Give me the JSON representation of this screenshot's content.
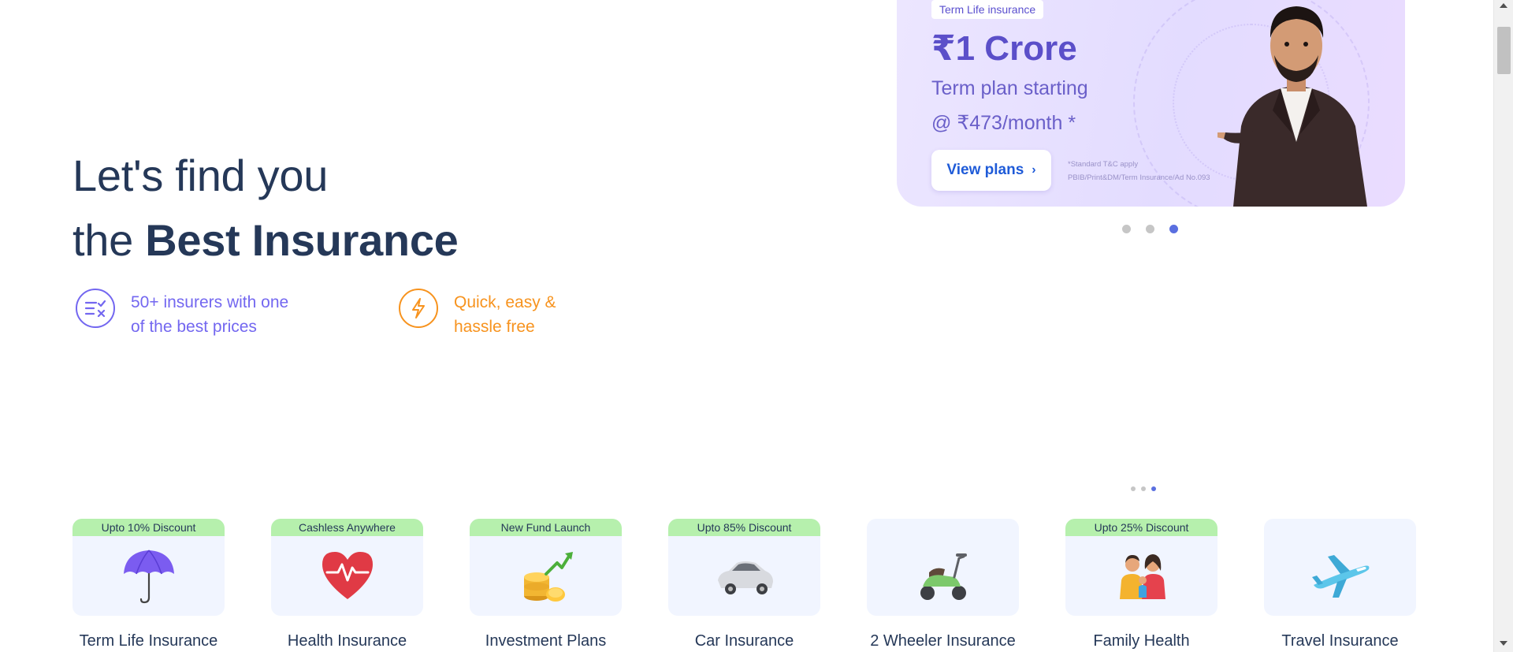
{
  "hero": {
    "line1": "Let's find you",
    "line2_prefix": "the ",
    "line2_bold": "Best Insurance"
  },
  "features": [
    {
      "line1": "50+ insurers with one",
      "line2": "of the best prices",
      "icon": "compare-icon",
      "color": "#7367f0"
    },
    {
      "line1": "Quick, easy &",
      "line2": "hassle free",
      "icon": "lightning-icon",
      "color": "#f7931e"
    }
  ],
  "banner": {
    "tag": "Term Life insurance",
    "amount": "₹1 Crore",
    "line1": "Term plan starting",
    "line2": "@ ₹473/month *",
    "cta": "View plans",
    "cta_icon": "chevron-right-icon",
    "tnc1": "*Standard T&C apply",
    "tnc2": "PBIB/Print&DM/Term Insurance/Ad No.093"
  },
  "carousel_dots": {
    "count": 3,
    "active": 3
  },
  "products": [
    {
      "badge": "Upto 10% Discount",
      "label": "Term Life Insurance",
      "icon": "umbrella-icon"
    },
    {
      "badge": "Cashless Anywhere",
      "label": "Health Insurance",
      "icon": "heart-pulse-icon"
    },
    {
      "badge": "New Fund Launch",
      "label": "Investment Plans",
      "icon": "coins-growth-icon"
    },
    {
      "badge": "Upto 85% Discount",
      "label": "Car Insurance",
      "icon": "car-icon"
    },
    {
      "badge": "",
      "label": "2 Wheeler Insurance",
      "icon": "scooter-icon"
    },
    {
      "badge": "Upto 25% Discount",
      "label": "Family Health",
      "icon": "family-icon"
    },
    {
      "badge": "",
      "label": "Travel Insurance",
      "icon": "airplane-icon"
    }
  ],
  "colors": {
    "primary_text": "#253858",
    "accent_purple": "#7367f0",
    "accent_orange": "#f7931e",
    "badge_green": "#b6f0ad",
    "card_bg": "#f1f5ff",
    "dot_active": "#5a6fe0"
  }
}
